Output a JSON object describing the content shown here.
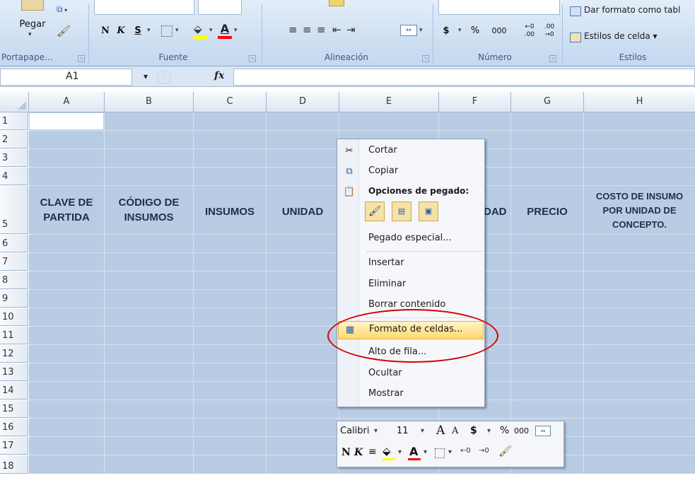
{
  "ribbon": {
    "paste_label": "Pegar",
    "bold_label": "N",
    "italic_label": "K",
    "underline_label": "S",
    "currency_label": "$",
    "percent_label": "%",
    "thousands_label": "000",
    "dec_inc_label": "←0 .00",
    "dec_dec_label": ".00 →0",
    "format_table_label": "Dar formato como tabl",
    "cell_styles_label": "Estilos de celda ▾",
    "groups": {
      "clipboard": "Portapape...",
      "font": "Fuente",
      "alignment": "Alineación",
      "number": "Número",
      "styles": "Estilos"
    },
    "icons": {
      "copy": "copy-icon",
      "format_painter": "format-painter-icon",
      "fill": "fill-color-icon",
      "font_color": "font-color-icon"
    },
    "fill_color": "#ffff00",
    "font_color": "#ff0000"
  },
  "formula_bar": {
    "name_box": "A1",
    "fx_label": "fx",
    "value": ""
  },
  "sheet": {
    "columns": [
      "A",
      "B",
      "C",
      "D",
      "E",
      "F",
      "G",
      "H"
    ],
    "rows": [
      "1",
      "2",
      "3",
      "4",
      "5",
      "6",
      "7",
      "8",
      "9",
      "10",
      "11",
      "12",
      "13",
      "14",
      "15",
      "16",
      "17",
      "18"
    ],
    "selection_color": "#b8cce4",
    "headers": {
      "a": [
        "CLAVE DE",
        "PARTIDA"
      ],
      "b": [
        "CÓDIGO DE",
        "INSUMOS"
      ],
      "c": "INSUMOS",
      "d": "UNIDAD",
      "f": "DAD",
      "g": "PRECIO",
      "h": [
        "COSTO DE INSUMO",
        "POR UNIDAD DE",
        "CONCEPTO."
      ]
    }
  },
  "context_menu": {
    "cut": "Cortar",
    "copy": "Copiar",
    "paste_options": "Opciones de pegado:",
    "paste_special": "Pegado especial...",
    "insert": "Insertar",
    "delete": "Eliminar",
    "clear": "Borrar contenido",
    "format_cells": "Formato de celdas...",
    "row_height": "Alto de fila...",
    "hide": "Ocultar",
    "show": "Mostrar"
  },
  "mini_toolbar": {
    "font": "Calibri",
    "size": "11",
    "grow": "A",
    "shrink": "A",
    "currency": "$",
    "percent": "%",
    "thousands": "000",
    "bold": "N",
    "italic": "K",
    "font_color_label": "A"
  }
}
